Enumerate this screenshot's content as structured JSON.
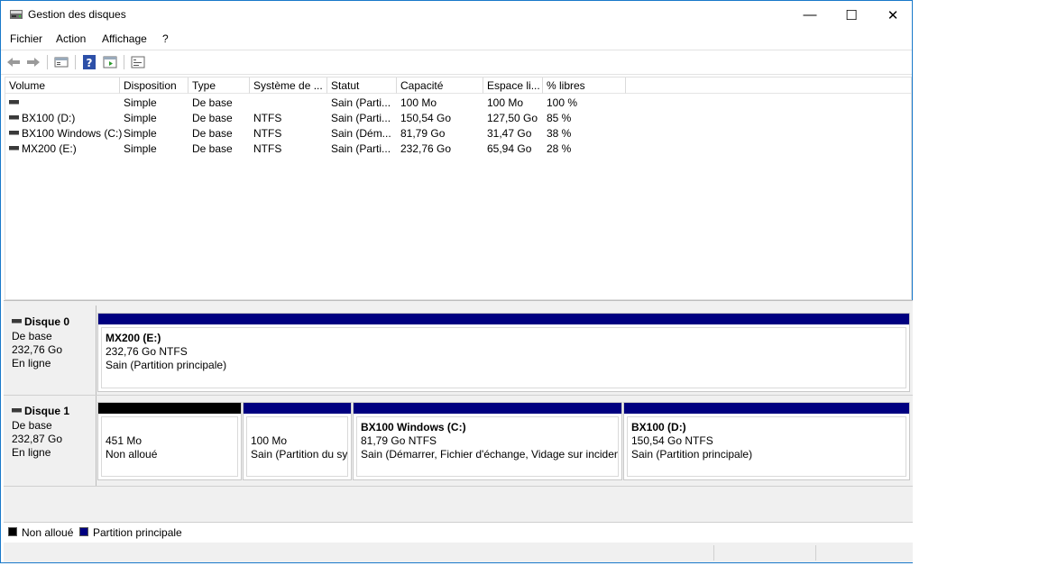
{
  "window": {
    "title": "Gestion des disques"
  },
  "titlebar": {
    "minimize": "—",
    "maximize": "☐",
    "close": "✕"
  },
  "menu": [
    "Fichier",
    "Action",
    "Affichage",
    "?"
  ],
  "toolbar": {
    "icons": [
      "back-arrow-icon",
      "forward-arrow-icon",
      "properties-icon",
      "help-icon",
      "view-icon",
      "console-icon"
    ]
  },
  "volume_table": {
    "columns": [
      "Volume",
      "Disposition",
      "Type",
      "Système de ...",
      "Statut",
      "Capacité",
      "Espace li...",
      "% libres"
    ],
    "rows": [
      [
        "",
        "Simple",
        "De base",
        "",
        "Sain (Parti...",
        "100 Mo",
        "100 Mo",
        "100 %"
      ],
      [
        "BX100 (D:)",
        "Simple",
        "De base",
        "NTFS",
        "Sain (Parti...",
        "150,54 Go",
        "127,50 Go",
        "85 %"
      ],
      [
        "BX100 Windows (C:)",
        "Simple",
        "De base",
        "NTFS",
        "Sain (Dém...",
        "81,79 Go",
        "31,47 Go",
        "38 %"
      ],
      [
        "MX200 (E:)",
        "Simple",
        "De base",
        "NTFS",
        "Sain (Parti...",
        "232,76 Go",
        "65,94 Go",
        "28 %"
      ]
    ]
  },
  "disks": [
    {
      "name": "Disque 0",
      "type": "De base",
      "size": "232,76 Go",
      "state": "En ligne",
      "partitions": [
        {
          "title": "MX200  (E:)",
          "line1": "232,76 Go NTFS",
          "line2": "Sain (Partition principale)",
          "color": "#000080"
        }
      ]
    },
    {
      "name": "Disque 1",
      "type": "De base",
      "size": "232,87 Go",
      "state": "En ligne",
      "partitions": [
        {
          "title": "",
          "line1": "451 Mo",
          "line2": "Non alloué",
          "color": "#000000"
        },
        {
          "title": "",
          "line1": "100 Mo",
          "line2": "Sain (Partition du sy",
          "color": "#000080"
        },
        {
          "title": "BX100 Windows  (C:)",
          "line1": "81,79 Go NTFS",
          "line2": "Sain (Démarrer, Fichier d'échange, Vidage sur incident",
          "color": "#000080"
        },
        {
          "title": "BX100  (D:)",
          "line1": "150,54 Go NTFS",
          "line2": "Sain (Partition principale)",
          "color": "#000080"
        }
      ]
    }
  ],
  "legend": [
    {
      "label": "Non alloué",
      "color": "#000000"
    },
    {
      "label": "Partition principale",
      "color": "#000080"
    }
  ]
}
